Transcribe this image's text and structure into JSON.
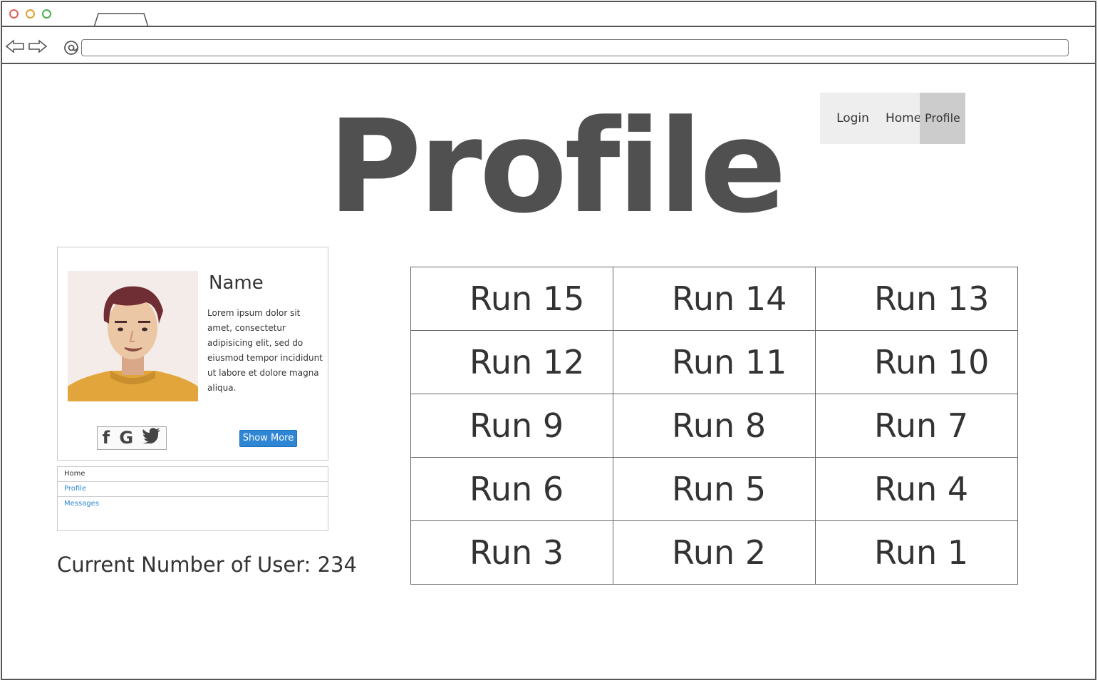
{
  "browser": {
    "url": ""
  },
  "page": {
    "title": "Profile"
  },
  "topnav": {
    "items": [
      {
        "label": "Login"
      },
      {
        "label": "Home"
      },
      {
        "label": "Profile",
        "active": true
      }
    ]
  },
  "profile_card": {
    "name": "Name",
    "bio": "Lorem ipsum dolor sit amet, consectetur adipisicing elit, sed do eiusmod tempor incididunt ut labore et dolore magna aliqua.",
    "social_icons": [
      "facebook-icon",
      "google-icon",
      "twitter-icon"
    ],
    "social_glyphs": {
      "facebook": "f",
      "google": "G",
      "twitter": "♥"
    },
    "show_more_label": "Show More"
  },
  "side_menu": {
    "items": [
      {
        "label": "Home"
      },
      {
        "label": "Profile"
      },
      {
        "label": "Messages"
      }
    ]
  },
  "user_count": {
    "text": "Current Number of User: 234"
  },
  "runs": {
    "rows": [
      [
        "Run 15",
        "Run 14",
        "Run 13"
      ],
      [
        "Run 12",
        "Run 11",
        "Run 10"
      ],
      [
        "Run 9",
        "Run 8",
        "Run 7"
      ],
      [
        "Run 6",
        "Run 5",
        "Run 4"
      ],
      [
        "Run 3",
        "Run 2",
        "Run 1"
      ]
    ]
  },
  "colors": {
    "accent": "#2f86d4",
    "nav_bg": "#eeeeee",
    "nav_active": "#cccccc",
    "title": "#505050"
  }
}
